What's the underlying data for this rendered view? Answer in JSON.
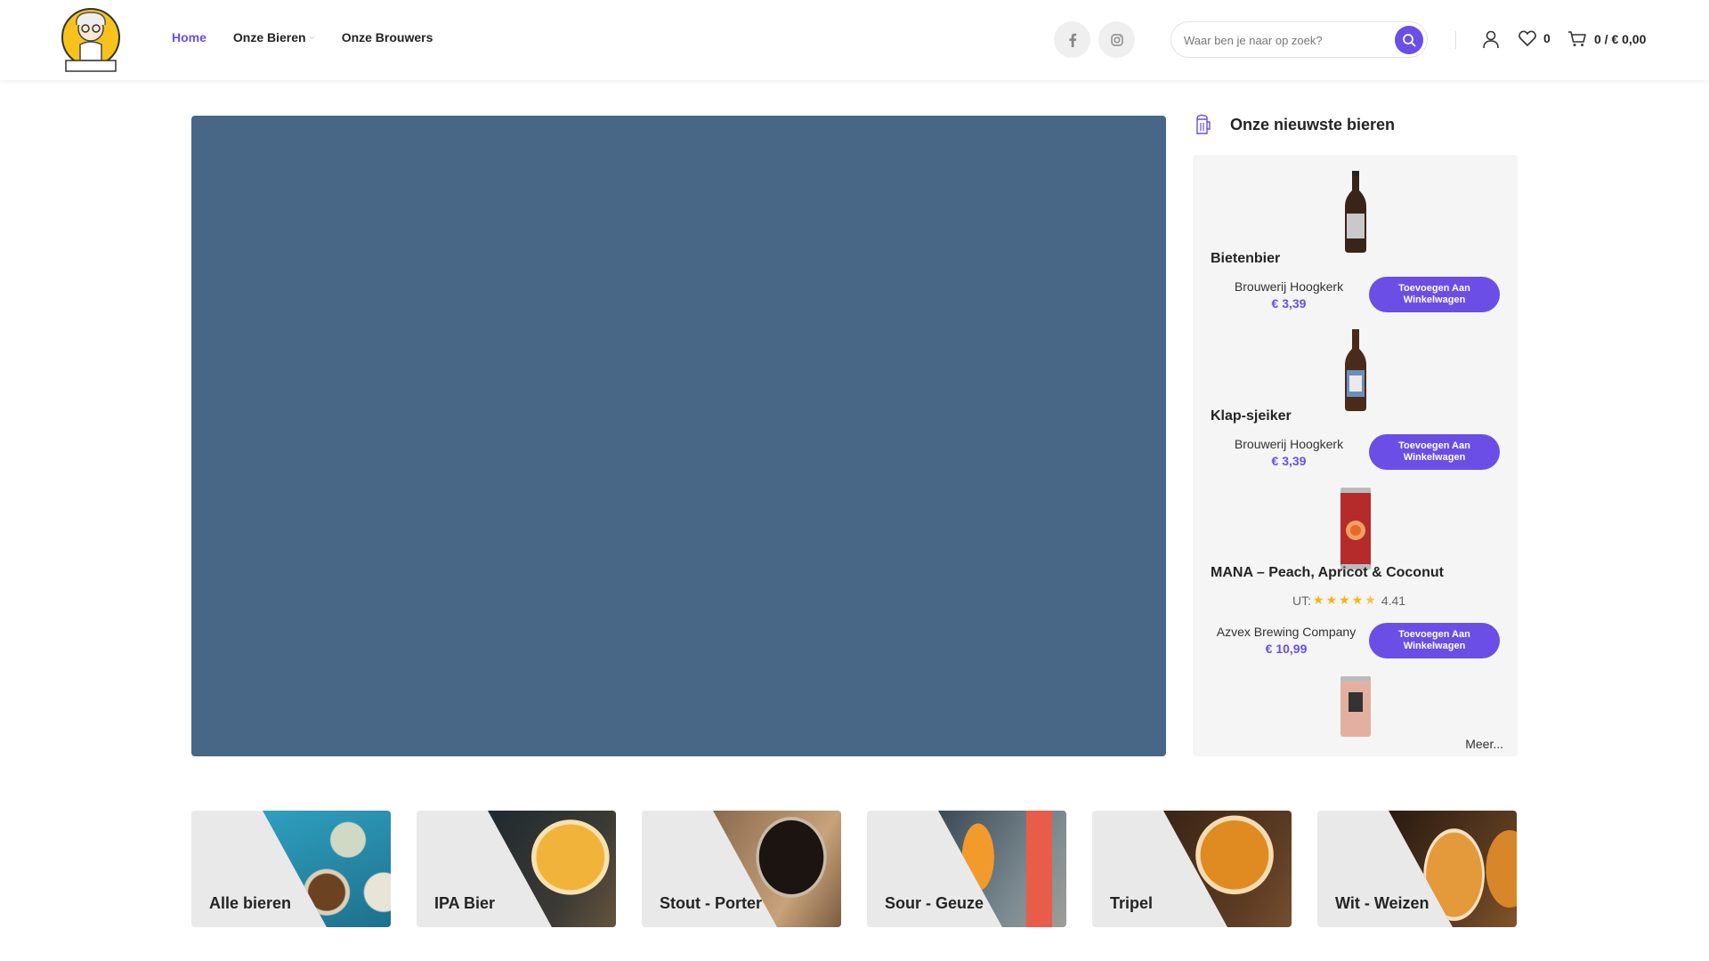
{
  "header": {
    "logo_alt": "DOKTER BIER",
    "nav": [
      {
        "label": "Home",
        "active": true
      },
      {
        "label": "Onze Bieren",
        "dropdown": true
      },
      {
        "label": "Onze Brouwers"
      }
    ],
    "social": [
      "facebook-icon",
      "instagram-icon"
    ],
    "search": {
      "placeholder": "Waar ben je naar op zoek?"
    },
    "wishlist_count": "0",
    "cart_summary": "0 / € 0,00",
    "accent": "#6a4ee6"
  },
  "hero": {
    "color": "#486787"
  },
  "sidebar": {
    "title": "Onze nieuwste bieren",
    "products": [
      {
        "name": "Bietenbier",
        "brewery": "Brouwerij Hoogkerk",
        "price": "€ 3,39",
        "button": "Toevoegen Aan Winkelwagen"
      },
      {
        "name": "Klap-sjeiker",
        "brewery": "Brouwerij Hoogkerk",
        "price": "€ 3,39",
        "button": "Toevoegen Aan Winkelwagen"
      },
      {
        "name": "MANA – Peach, Apricot & Coconut",
        "rating_prefix": "UT:",
        "rating": 4.41,
        "rating_text": "4.41",
        "brewery": "Azvex Brewing Company",
        "price": "€ 10,99",
        "button": "Toevoegen Aan Winkelwagen"
      }
    ],
    "more": "Meer..."
  },
  "categories": [
    {
      "label": "Alle bieren"
    },
    {
      "label": "IPA Bier"
    },
    {
      "label": "Stout - Porter"
    },
    {
      "label": "Sour - Geuze"
    },
    {
      "label": "Tripel"
    },
    {
      "label": "Wit - Weizen"
    }
  ]
}
